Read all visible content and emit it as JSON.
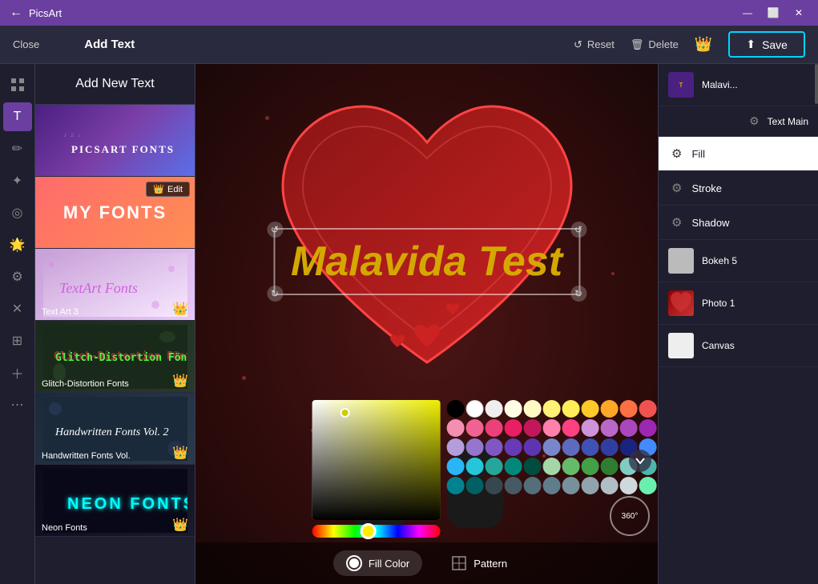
{
  "window": {
    "title": "PicsArt",
    "min_label": "—",
    "max_label": "⬜",
    "close_label": "✕",
    "back_label": "←"
  },
  "toolbar": {
    "close_label": "Close",
    "title": "Add Text",
    "reset_label": "Reset",
    "delete_label": "Delete",
    "save_label": "Save"
  },
  "font_panel": {
    "add_new_text": "Add New Text",
    "sections": [
      {
        "name": "picsart-fonts",
        "label": "PICSART FONTS",
        "type": "picsart"
      },
      {
        "name": "my-fonts",
        "label": "MY FONTS",
        "type": "myfonts",
        "edit": "Edit"
      },
      {
        "name": "textart",
        "label": "Text Art 3",
        "type": "textart",
        "label_text": "TextArt Fonts"
      },
      {
        "name": "glitch",
        "label": "Glitch-Distortion Fonts",
        "type": "glitch",
        "label_text": "Glitch-Distortion Fönts"
      },
      {
        "name": "handwritten",
        "label": "Handwritten Fonts Vol.",
        "type": "handwritten",
        "label_text": "Handwritten Fonts Vol. 2"
      },
      {
        "name": "neon",
        "label": "Neon Fonts",
        "type": "neon",
        "label_text": "NEON FONTS"
      }
    ]
  },
  "canvas": {
    "text": "Malavida Test"
  },
  "color_picker": {
    "fill_color_label": "Fill Color",
    "pattern_label": "Pattern",
    "swatches": [
      [
        "#000000",
        "#ffffff",
        "#eeeeee",
        "#dddddd",
        "#f5f5f5",
        "#fffde7",
        "#fff9c4",
        "#fff176",
        "#ffee58",
        "#ffca28",
        "#ffa726",
        "#ff7043",
        "#ef5350"
      ],
      [
        "#e53935",
        "#d32f2f",
        "#b71c1c",
        "#ff1744",
        "#f48fb1",
        "#f06292",
        "#ec407a",
        "#e91e63",
        "#c2185b",
        "#ad1457",
        "#880e4f",
        "#ff80ab",
        "#ff4081"
      ],
      [
        "#ce93d8",
        "#ba68c8",
        "#ab47bc",
        "#9c27b0",
        "#7b1fa2",
        "#6a1b9a",
        "#4a148c",
        "#b39ddb",
        "#9575cd",
        "#7e57c2",
        "#673ab7",
        "#5e35b1",
        "#512da8"
      ],
      [
        "#7986cb",
        "#5c6bc0",
        "#3f51b5",
        "#3949ab",
        "#303f9f",
        "#1a237e",
        "#82b1ff",
        "#448aff",
        "#2979ff",
        "#2962ff",
        "#42a5f5",
        "#29b6f6",
        "#26c6da"
      ],
      [
        "#26a69a",
        "#00897b",
        "#00796b",
        "#00695c",
        "#004d40",
        "#a5d6a7",
        "#66bb6a",
        "#43a047",
        "#388e3c",
        "#2e7d32",
        "#1b5e20",
        "#b9f6ca",
        "#69f0ae"
      ],
      [
        "#80cbc4",
        "#4db6ac",
        "#009688",
        "#00bcd4",
        "#00acc1",
        "#0097a7",
        "#00838f",
        "#006064",
        "#b2ebf2",
        "#80deea",
        "#4dd0e1",
        "#26c6da",
        "#00bcd4"
      ],
      [
        "#00838f",
        "#006064",
        "#37474f",
        "#455a64",
        "#546e7a",
        "#607d8b",
        "#78909c",
        "#90a4ae",
        "#b0bec5",
        "#cfd8dc",
        "#eceff1",
        "#fafafa",
        "#f5f5f5"
      ]
    ]
  },
  "right_panel": {
    "layers": [
      {
        "name": "Malavi...",
        "type": "text",
        "has_gear": false
      },
      {
        "name": "Text Main",
        "type": "text-gear",
        "has_gear": true
      },
      {
        "name": "Fill",
        "type": "setting",
        "active": true
      },
      {
        "name": "Stroke",
        "type": "setting",
        "active": false
      },
      {
        "name": "Shadow",
        "type": "setting",
        "active": false
      },
      {
        "name": "Bokeh 5",
        "type": "bokeh",
        "has_gear": false
      },
      {
        "name": "Photo 1",
        "type": "photo",
        "has_gear": false
      },
      {
        "name": "Canvas",
        "type": "canvas",
        "has_gear": false
      }
    ]
  },
  "tools": [
    "⊞",
    "T",
    "🖊",
    "✱",
    "◎",
    "🔨",
    "⚙",
    "✦",
    "↗",
    "⊕",
    "⋯"
  ]
}
